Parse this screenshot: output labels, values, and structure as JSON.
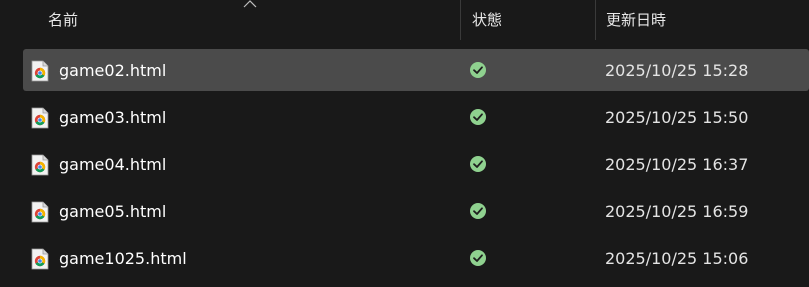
{
  "columns": {
    "name": "名前",
    "status": "状態",
    "modified": "更新日時"
  },
  "files": [
    {
      "name": "game02.html",
      "status": "synced",
      "modified": "2025/10/25 15:28",
      "selected": true
    },
    {
      "name": "game03.html",
      "status": "synced",
      "modified": "2025/10/25 15:50",
      "selected": false
    },
    {
      "name": "game04.html",
      "status": "synced",
      "modified": "2025/10/25 16:37",
      "selected": false
    },
    {
      "name": "game05.html",
      "status": "synced",
      "modified": "2025/10/25 16:59",
      "selected": false
    },
    {
      "name": "game1025.html",
      "status": "synced",
      "modified": "2025/10/25 15:06",
      "selected": false
    }
  ],
  "icons": {
    "file": "chrome-html-file-icon",
    "status": "check-circle-icon",
    "sort": "chevron-up-icon"
  },
  "colors": {
    "background": "#191919",
    "selected_row": "#4b4b4b",
    "status_green": "#8fd18f"
  }
}
